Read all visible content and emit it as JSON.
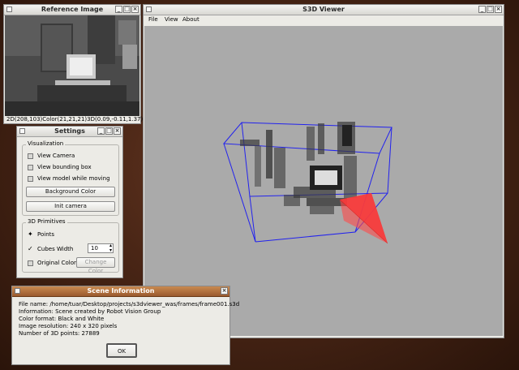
{
  "reference_window": {
    "title": "Reference Image",
    "status": "2D(208,103)Color(21,21,21)3D(0.09,-0.11,1.37)"
  },
  "viewer_window": {
    "title": "S3D Viewer",
    "menu": [
      "File",
      "View",
      "About"
    ],
    "viewport_bg": "#aaaaaa",
    "box_color": "#2222ee",
    "camera_color": "#ee2222"
  },
  "settings_window": {
    "title": "Settings",
    "visualization": {
      "title": "Visualization",
      "options": [
        "View Camera",
        "View bounding box",
        "View model while moving"
      ],
      "background_button": "Background Color",
      "init_button": "Init camera"
    },
    "primitives": {
      "title": "3D Primitives",
      "points_label": "Points",
      "cubes_label": "Cubes",
      "width_label": "Width",
      "width_value": "10",
      "original_color_label": "Original Color",
      "change_color_button": "Change Color"
    }
  },
  "scene_window": {
    "title": "Scene Information",
    "lines": [
      "File name: /home/tuar/Desktop/projects/s3dviewer_was/frames/frame001.s3d",
      "Information: Scene created by Robot Vision Group",
      "Color format: Black and White",
      "Image resolution: 240 x 320 pixels",
      "Number of 3D points: 27889"
    ],
    "ok_button": "OK"
  }
}
